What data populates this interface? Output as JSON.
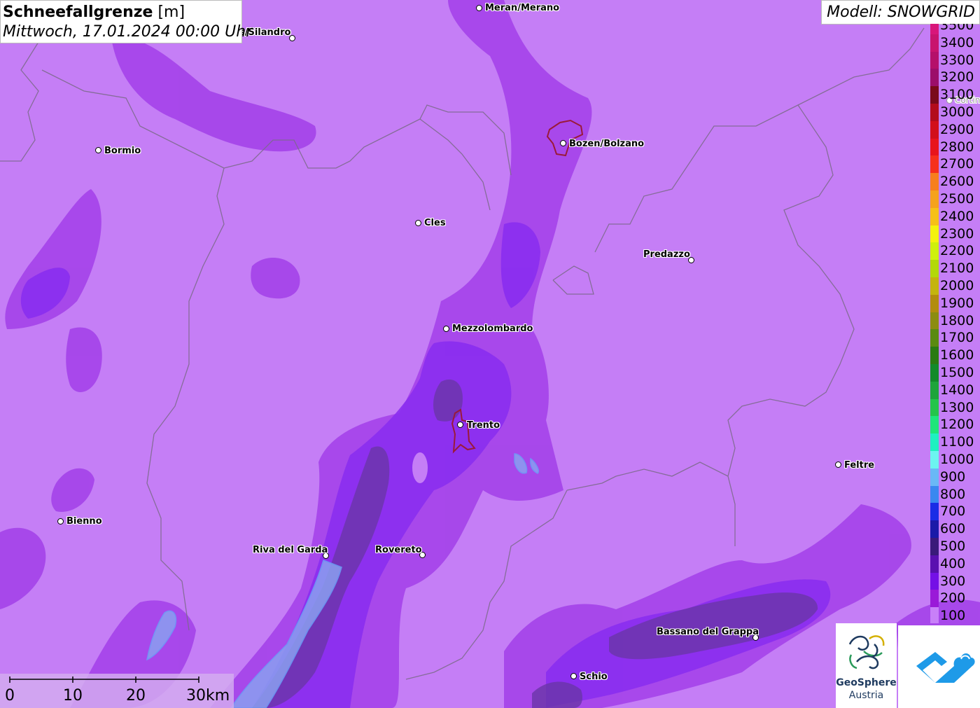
{
  "title": {
    "main": "Schneefallgrenze",
    "unit": "[m]",
    "datetime": "Mittwoch, 17.01.2024 00:00 Uhr"
  },
  "model": "Modell: SNOWGRID",
  "legend": [
    {
      "label": "3500",
      "color": "#d8167a"
    },
    {
      "label": "3400",
      "color": "#c8146e"
    },
    {
      "label": "3300",
      "color": "#b5106a"
    },
    {
      "label": "3200",
      "color": "#9c0e6a"
    },
    {
      "label": "3100",
      "color": "#7a0a1a"
    },
    {
      "label": "3000",
      "color": "#b30c1c"
    },
    {
      "label": "2900",
      "color": "#d20f1a"
    },
    {
      "label": "2800",
      "color": "#e8141c"
    },
    {
      "label": "2700",
      "color": "#f6301c"
    },
    {
      "label": "2600",
      "color": "#f77f1e"
    },
    {
      "label": "2500",
      "color": "#f5a21e"
    },
    {
      "label": "2400",
      "color": "#f6c018"
    },
    {
      "label": "2300",
      "color": "#f4f20e"
    },
    {
      "label": "2200",
      "color": "#cff00c"
    },
    {
      "label": "2100",
      "color": "#b3d80a"
    },
    {
      "label": "2000",
      "color": "#c4b40e"
    },
    {
      "label": "1900",
      "color": "#b28c0e"
    },
    {
      "label": "1800",
      "color": "#8c8c10"
    },
    {
      "label": "1700",
      "color": "#5a8a10"
    },
    {
      "label": "1600",
      "color": "#2a7a12"
    },
    {
      "label": "1500",
      "color": "#138a2a"
    },
    {
      "label": "1400",
      "color": "#1ea43a"
    },
    {
      "label": "1300",
      "color": "#24c44a"
    },
    {
      "label": "1200",
      "color": "#1ee67a"
    },
    {
      "label": "1100",
      "color": "#1ef0c0"
    },
    {
      "label": "1000",
      "color": "#6cf4f0"
    },
    {
      "label": "900",
      "color": "#6ab8f6"
    },
    {
      "label": "800",
      "color": "#3a88f0"
    },
    {
      "label": "700",
      "color": "#1a2ce6"
    },
    {
      "label": "600",
      "color": "#1a1aa8"
    },
    {
      "label": "500",
      "color": "#3a1a7a"
    },
    {
      "label": "400",
      "color": "#5a10b0"
    },
    {
      "label": "300",
      "color": "#7410e6"
    },
    {
      "label": "200",
      "color": "#9a1ad8"
    },
    {
      "label": "100",
      "color": "#c880f8"
    }
  ],
  "cities": [
    {
      "name": "Meran/Merano",
      "id": "meran"
    },
    {
      "name": "s/Silandro",
      "id": "silandro"
    },
    {
      "name": "Bormio",
      "id": "bormio"
    },
    {
      "name": "Bozen/Bolzano",
      "id": "bozen"
    },
    {
      "name": "Cles",
      "id": "cles"
    },
    {
      "name": "Predazzo",
      "id": "predazzo"
    },
    {
      "name": "Mezzolombardo",
      "id": "mezzolombardo"
    },
    {
      "name": "Trento",
      "id": "trento"
    },
    {
      "name": "Feltre",
      "id": "feltre"
    },
    {
      "name": "Bienno",
      "id": "bienno"
    },
    {
      "name": "Riva del Garda",
      "id": "riva"
    },
    {
      "name": "Rovereto",
      "id": "rovereto"
    },
    {
      "name": "Bassano del Grappa",
      "id": "bassano"
    },
    {
      "name": "Schio",
      "id": "schio"
    },
    {
      "name": "Cortin",
      "id": "cortina"
    }
  ],
  "scale": {
    "labels": [
      "0",
      "10",
      "20",
      "30km"
    ]
  },
  "logo": {
    "line1": "GeoSphere",
    "line2": "Austria"
  }
}
